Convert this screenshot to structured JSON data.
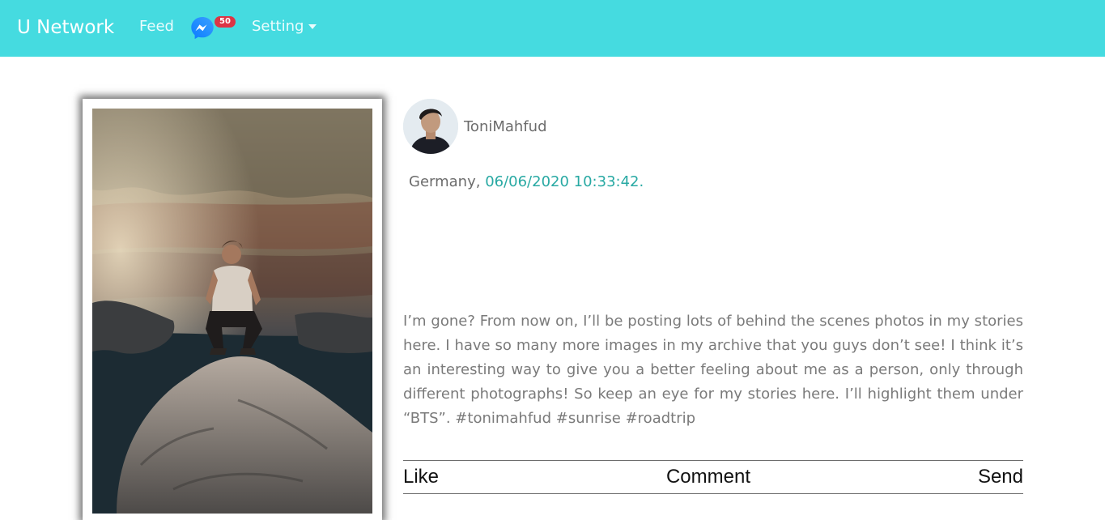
{
  "navbar": {
    "brand": "U  Network",
    "feed_label": "Feed",
    "messenger_icon": "messenger-icon",
    "messages_count": "50",
    "setting_label": "Setting"
  },
  "post": {
    "username": "ToniMahfud",
    "location": "Germany, ",
    "datetime": "06/06/2020 10:33:42.",
    "text": "I’m gone? From now on, I’ll be posting lots of behind the scenes photos in my stories here. I have so many more images in my archive that you guys don’t see! I think it’s an interesting way to give you a better feeling about me as a person, only through different photographs! So keep an eye for my stories here. I’ll highlight them under “BTS”. #tonimahfud #sunrise #roadtrip",
    "actions": {
      "like": "Like",
      "comment": "Comment",
      "send": "Send"
    }
  },
  "colors": {
    "navbar": "#45dbe0",
    "date_accent": "#28a9a3",
    "badge": "#dc3545"
  }
}
